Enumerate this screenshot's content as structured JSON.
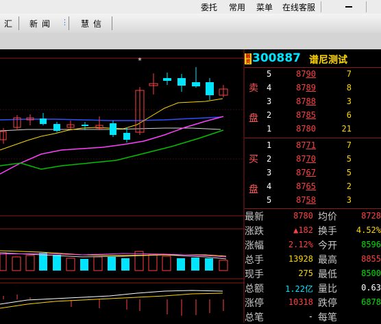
{
  "menu": {
    "items": [
      "委托",
      "常用",
      "菜单",
      "在线客服"
    ],
    "minimize_icon": "minimize-icon"
  },
  "tabs": [
    "汇",
    "新闻",
    "慧信"
  ],
  "chart": {
    "marker": "*"
  },
  "quote": {
    "badge": "融资",
    "code": "300887",
    "name": "谱尼测试",
    "sell_label": [
      "卖",
      "盘"
    ],
    "buy_label": [
      "买",
      "盘"
    ],
    "sell_levels": [
      {
        "level": "5",
        "price_main": "87",
        "price_ul": "90",
        "volume": "7"
      },
      {
        "level": "4",
        "price_main": "87",
        "price_ul": "89",
        "volume": "8"
      },
      {
        "level": "3",
        "price_main": "87",
        "price_ul": "88",
        "volume": "3"
      },
      {
        "level": "2",
        "price_main": "87",
        "price_ul": "85",
        "volume": "6"
      },
      {
        "level": "1",
        "price_main": "8780",
        "price_ul": "",
        "volume": "21"
      }
    ],
    "buy_levels": [
      {
        "level": "1",
        "price_main": "87",
        "price_ul": "71",
        "volume": "7"
      },
      {
        "level": "2",
        "price_main": "87",
        "price_ul": "70",
        "volume": "5"
      },
      {
        "level": "3",
        "price_main": "87",
        "price_ul": "67",
        "volume": "5"
      },
      {
        "level": "4",
        "price_main": "87",
        "price_ul": "65",
        "volume": "2"
      },
      {
        "level": "5",
        "price_main": "87",
        "price_ul": "58",
        "volume": "3"
      }
    ],
    "stats": [
      {
        "l1": "最新",
        "v1": "8780",
        "c1": "#ff4040",
        "l2": "均价",
        "v2": "8728",
        "c2": "#ff4040"
      },
      {
        "l1": "涨跌",
        "v1": "▲182",
        "c1": "#ff4040",
        "l2": "换手",
        "v2": "4.52%",
        "c2": "#ffd700"
      },
      {
        "l1": "涨幅",
        "v1": "2.12%",
        "c1": "#ff4040",
        "l2": "今开",
        "v2": "8596",
        "c2": "#00e000"
      },
      {
        "l1": "总手",
        "v1": "13928",
        "c1": "#ffd700",
        "l2": "最高",
        "v2": "8855",
        "c2": "#ff4040"
      },
      {
        "l1": "现手",
        "v1": "275",
        "c1": "#ffd700",
        "l2": "最低",
        "v2": "8500",
        "c2": "#00e000"
      },
      {
        "l1": "总额",
        "v1": "1.22亿",
        "c1": "#00e5ff",
        "l2": "量比",
        "v2": "0.63",
        "c2": "#ffffff"
      },
      {
        "l1": "涨停",
        "v1": "10318",
        "c1": "#ff4040",
        "l2": "跌停",
        "v2": "6878",
        "c2": "#00e000"
      },
      {
        "l1": "总笔",
        "v1": "-",
        "c1": "#ffffff",
        "l2": "每笔",
        "v2": "",
        "c2": "#ffffff"
      }
    ]
  },
  "colors": {
    "up": "#ff4040",
    "down": "#00e5ff",
    "ma_yellow": "#ffd700",
    "ma_magenta": "#ff40ff",
    "ma_green": "#00c000",
    "ma_blue": "#3050ff"
  }
}
